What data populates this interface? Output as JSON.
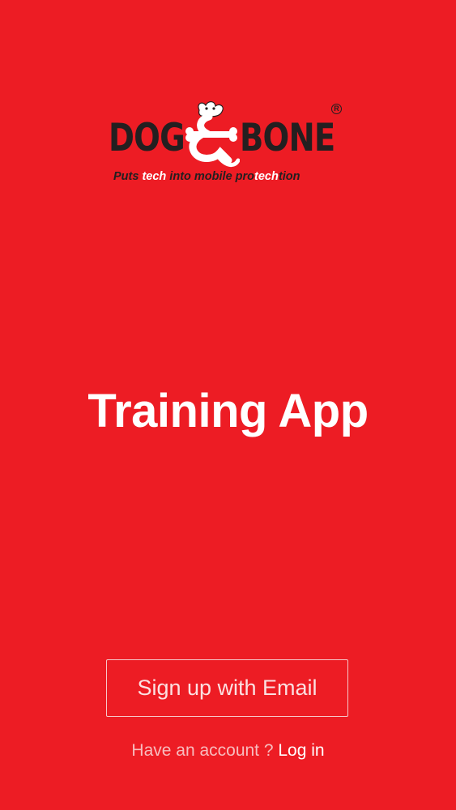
{
  "brand": {
    "word_left": "DOG",
    "word_right": "BONE",
    "registered_mark": "R",
    "tagline_parts": [
      "Puts ",
      "tech",
      " into mobile pro",
      "tech",
      "tion"
    ],
    "primary_color": "#ed1c24",
    "text_color": "#231f20"
  },
  "title": "Training App",
  "signup": {
    "label": "Sign up with Email"
  },
  "login": {
    "prompt": "Have an account ? ",
    "link_label": "Log in"
  }
}
